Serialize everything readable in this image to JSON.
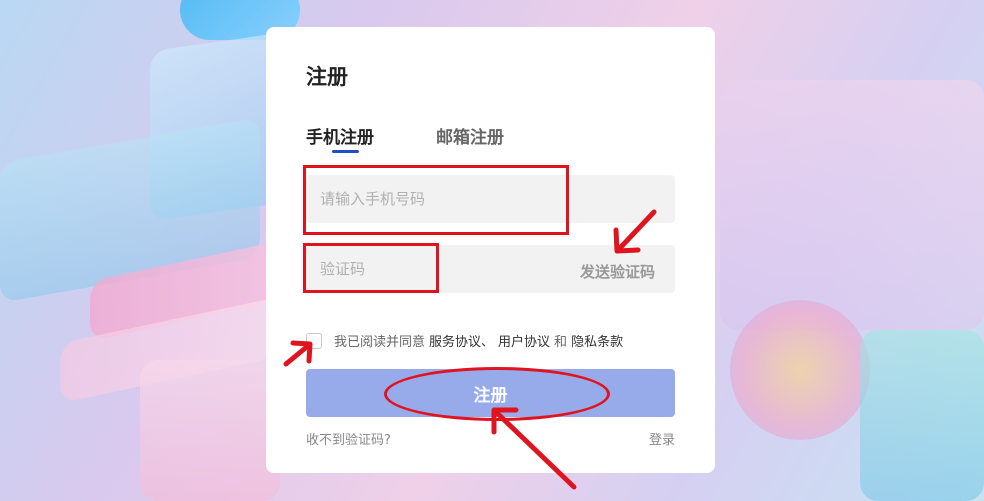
{
  "form": {
    "title": "注册",
    "tabs": [
      {
        "label": "手机注册",
        "active": true
      },
      {
        "label": "邮箱注册",
        "active": false
      }
    ],
    "phone": {
      "placeholder": "请输入手机号码",
      "value": ""
    },
    "code": {
      "placeholder": "验证码",
      "value": "",
      "send_label": "发送验证码"
    },
    "agreement": {
      "prefix": "我已阅读并同意",
      "service": "服务协议、",
      "user": "用户协议",
      "and": "和",
      "privacy": "隐私条款",
      "checked": false
    },
    "submit_label": "注册",
    "no_code_label": "收不到验证码?",
    "login_label": "登录"
  },
  "colors": {
    "accent": "#1f4fc6",
    "button": "#97abeb",
    "annotation": "#e0141e"
  }
}
